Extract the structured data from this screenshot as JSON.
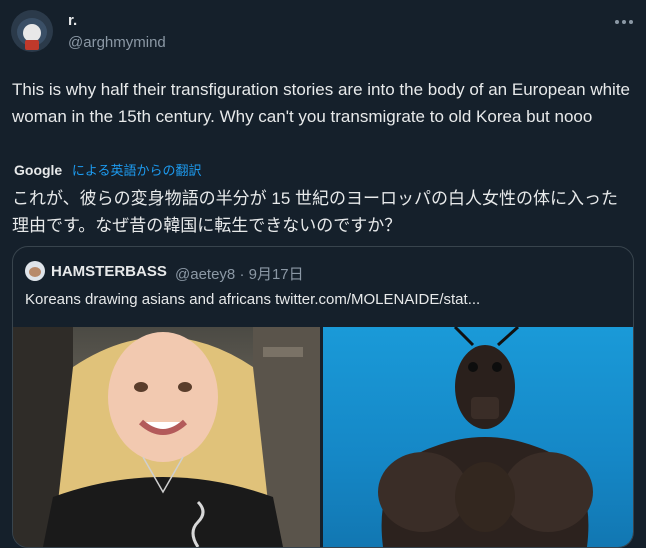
{
  "tweet": {
    "display_name": "r.",
    "handle": "@arghmymind",
    "text": "This is why half their transfiguration stories are into the body of an European white woman in the 15th century. Why can't you transmigrate to old Korea but nooo",
    "translation_provider": "Google",
    "translation_link": "による英語からの翻訳",
    "translated_text": "これが、彼らの変身物語の半分が 15 世紀のヨーロッパの白人女性の体に入った理由です。なぜ昔の韓国に転生できないのですか？"
  },
  "quoted_tweet": {
    "display_name": "HAMSTERBASS",
    "handle": "@aetey8",
    "separator": "·",
    "date": "9月17日",
    "text": "Koreans drawing asians and africans  twitter.com/MOLENAIDE/stat..."
  },
  "icons": {
    "more": "more-horizontal-icon"
  },
  "colors": {
    "background": "#15202b",
    "link": "#1d9bf0",
    "secondary_text": "#8b98a5",
    "border": "#38444d"
  }
}
